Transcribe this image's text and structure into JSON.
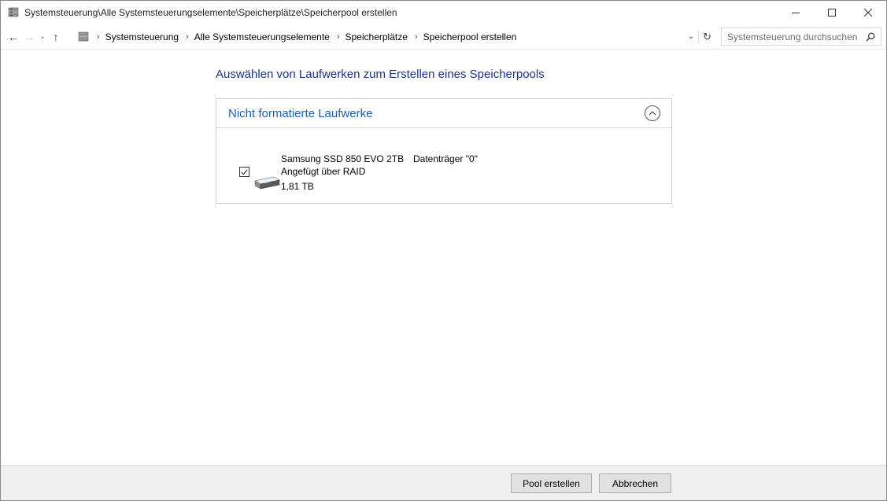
{
  "window": {
    "title": "Systemsteuerung\\Alle Systemsteuerungselemente\\Speicherplätze\\Speicherpool erstellen",
    "icon": "storage-spaces-icon",
    "controls": {
      "minimize": "—",
      "maximize": "☐",
      "close": "✕"
    }
  },
  "nav": {
    "back": "←",
    "forward": "→",
    "recent": "⌄",
    "up": "↑",
    "breadcrumbs": [
      "Systemsteuerung",
      "Alle Systemsteuerungselemente",
      "Speicherplätze",
      "Speicherpool erstellen"
    ],
    "separator": "›",
    "dropdown": "⌄",
    "refresh": "↻",
    "search_placeholder": "Systemsteuerung durchsuchen"
  },
  "main": {
    "heading": "Auswählen von Laufwerken zum Erstellen eines Speicherpools",
    "group": {
      "title": "Nicht formatierte Laufwerke",
      "drives": [
        {
          "checked": true,
          "name": "Samsung SSD 850 EVO 2TB",
          "connection": "Angefügt über RAID",
          "size": "1,81 TB",
          "disk": "Datenträger \"0\""
        }
      ]
    }
  },
  "footer": {
    "create_label": "Pool erstellen",
    "cancel_label": "Abbrechen"
  },
  "colors": {
    "heading": "#1e3287",
    "group_title": "#1a5fb4",
    "footer_bg": "#f0f0f0"
  }
}
